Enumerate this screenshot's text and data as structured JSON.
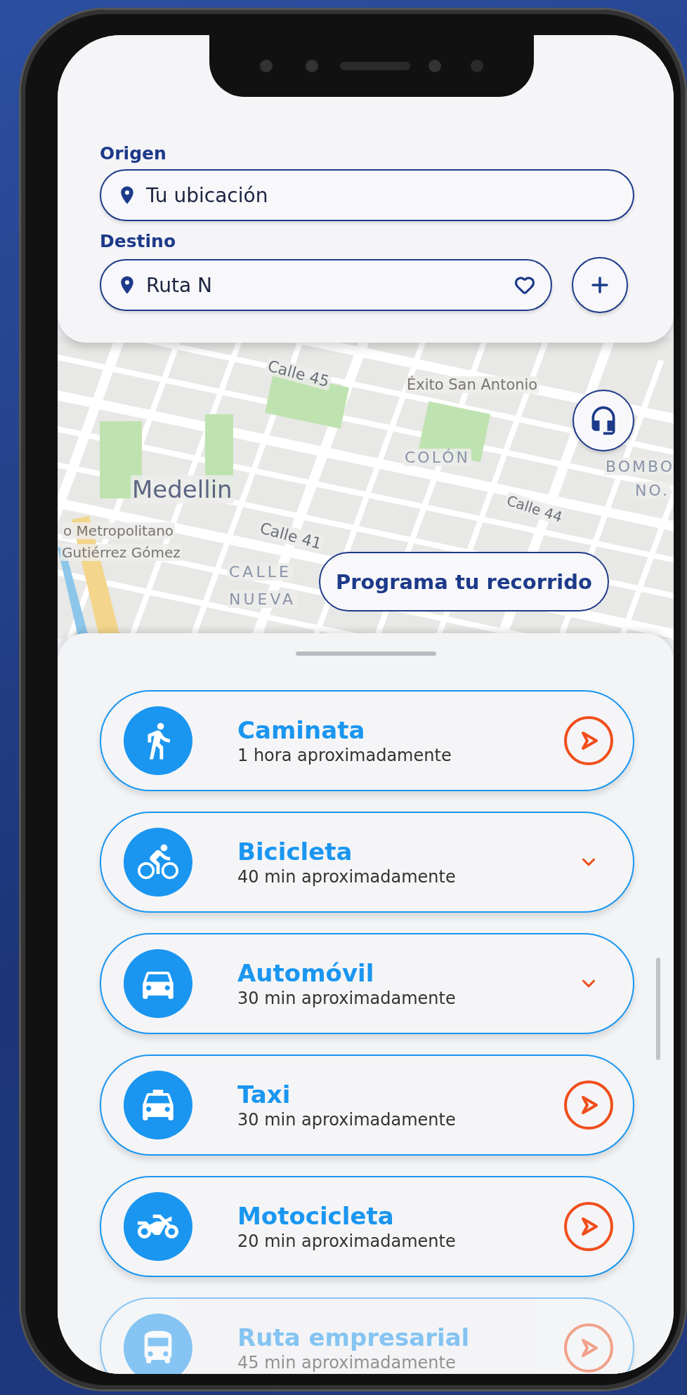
{
  "route_form": {
    "origin": {
      "label": "Origen",
      "value": "Tu ubicación"
    },
    "destination": {
      "label": "Destino",
      "value": "Ruta N"
    }
  },
  "map": {
    "labels": [
      {
        "text": "Calle 45",
        "kind": "street"
      },
      {
        "text": "Éxito San Antonio",
        "kind": "poi"
      },
      {
        "text": "COLÓN",
        "kind": "district"
      },
      {
        "text": "BOMBO",
        "kind": "district"
      },
      {
        "text": "NO.",
        "kind": "district"
      },
      {
        "text": "Medellin",
        "kind": "city"
      },
      {
        "text": "Calle 44",
        "kind": "street"
      },
      {
        "text": "Calle 41",
        "kind": "street"
      },
      {
        "text": "o Metropolitano",
        "kind": "poi"
      },
      {
        "text": "Gutiérrez Gómez",
        "kind": "poi"
      },
      {
        "text": "CALLE",
        "kind": "district"
      },
      {
        "text": "NUEVA",
        "kind": "district"
      }
    ],
    "schedule_button": "Programa tu recorrido"
  },
  "transport_options": [
    {
      "title": "Caminata",
      "subtitle": "1 hora aproximadamente",
      "kind": "play",
      "faded": false
    },
    {
      "title": "Bicicleta",
      "subtitle": "40 min aproximadamente",
      "kind": "expand",
      "faded": false
    },
    {
      "title": "Automóvil",
      "subtitle": "30 min aproximadamente",
      "kind": "expand",
      "faded": false
    },
    {
      "title": "Taxi",
      "subtitle": "30 min aproximadamente",
      "kind": "play",
      "faded": false
    },
    {
      "title": "Motocicleta",
      "subtitle": "20 min aproximadamente",
      "kind": "play",
      "faded": false
    },
    {
      "title": "Ruta empresarial",
      "subtitle": "45 min aproximadamente",
      "kind": "play",
      "faded": true
    }
  ]
}
